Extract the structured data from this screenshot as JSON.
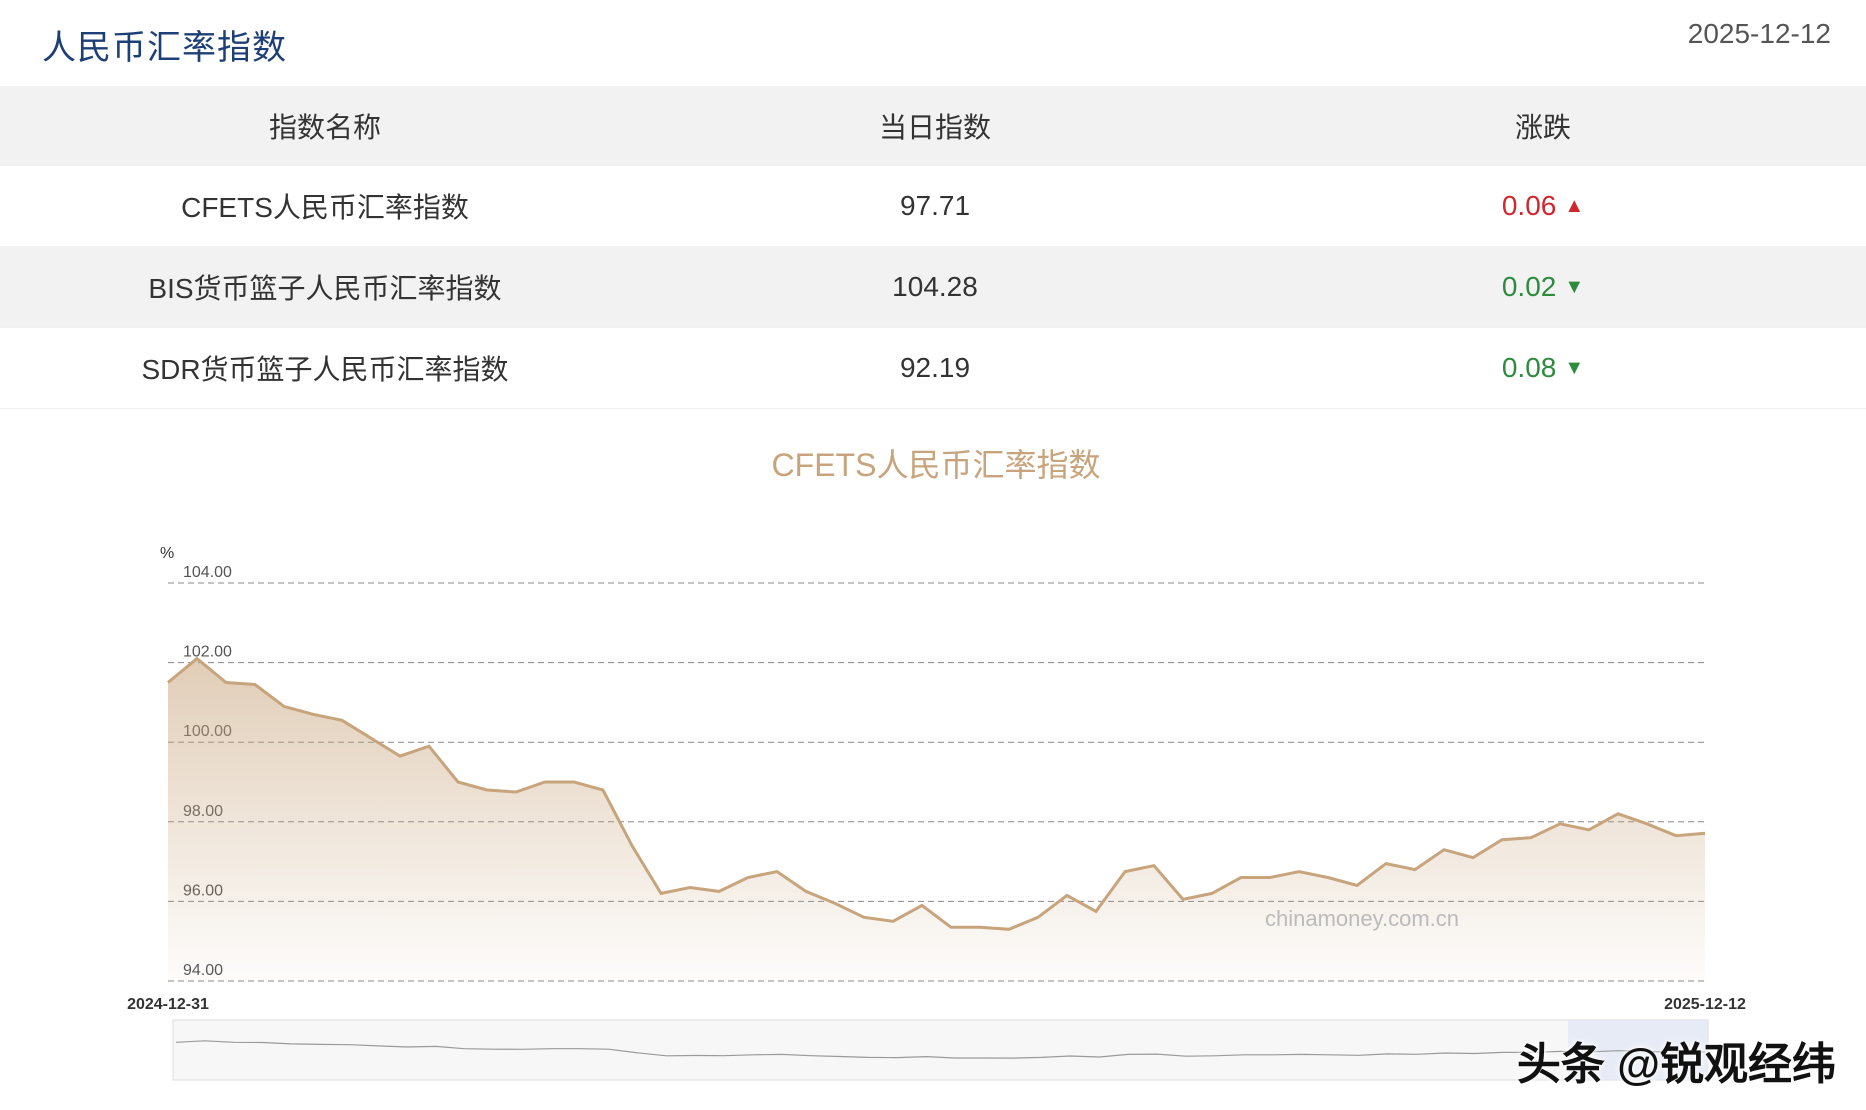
{
  "header": {
    "title": "人民币汇率指数",
    "date": "2025-12-12"
  },
  "table": {
    "columns": [
      "指数名称",
      "当日指数",
      "涨跌"
    ],
    "rows": [
      {
        "name": "CFETS人民币汇率指数",
        "value": "97.71",
        "change": "0.06",
        "direction": "up"
      },
      {
        "name": "BIS货币篮子人民币汇率指数",
        "value": "104.28",
        "change": "0.02",
        "direction": "down"
      },
      {
        "name": "SDR货币篮子人民币汇率指数",
        "value": "92.19",
        "change": "0.08",
        "direction": "down"
      }
    ]
  },
  "colors": {
    "up": "#d0262d",
    "down": "#2e8b3e",
    "line": "#c8a47c",
    "title_accent": "#c8a47c"
  },
  "chart_data": {
    "type": "area",
    "title": "CFETS人民币汇率指数",
    "ylabel": "%",
    "ylim": [
      94,
      104
    ],
    "yticks": [
      "104.00",
      "102.00",
      "100.00",
      "98.00",
      "96.00",
      "94.00"
    ],
    "grid": true,
    "x_start_label": "2024-12-31",
    "x_end_label": "2025-12-12",
    "watermark": "chinamoney.com.cn",
    "series": [
      {
        "values": [
          101.5,
          102.1,
          101.5,
          101.45,
          100.9,
          100.7,
          100.55,
          100.1,
          99.65,
          99.9,
          99.0,
          98.8,
          98.75,
          99.0,
          99.0,
          98.8,
          97.4,
          96.2,
          96.35,
          96.25,
          96.6,
          96.75,
          96.25,
          95.95,
          95.6,
          95.5,
          95.9,
          95.35,
          95.35,
          95.3,
          95.6,
          96.15,
          95.75,
          96.75,
          96.9,
          96.05,
          96.2,
          96.6,
          96.6,
          96.75,
          96.6,
          96.4,
          96.95,
          96.8,
          97.3,
          97.1,
          97.55,
          97.6,
          97.95,
          97.8,
          98.2,
          97.95,
          97.65,
          97.71
        ]
      }
    ]
  },
  "watermark_brand": "头条 @锐观经纬"
}
